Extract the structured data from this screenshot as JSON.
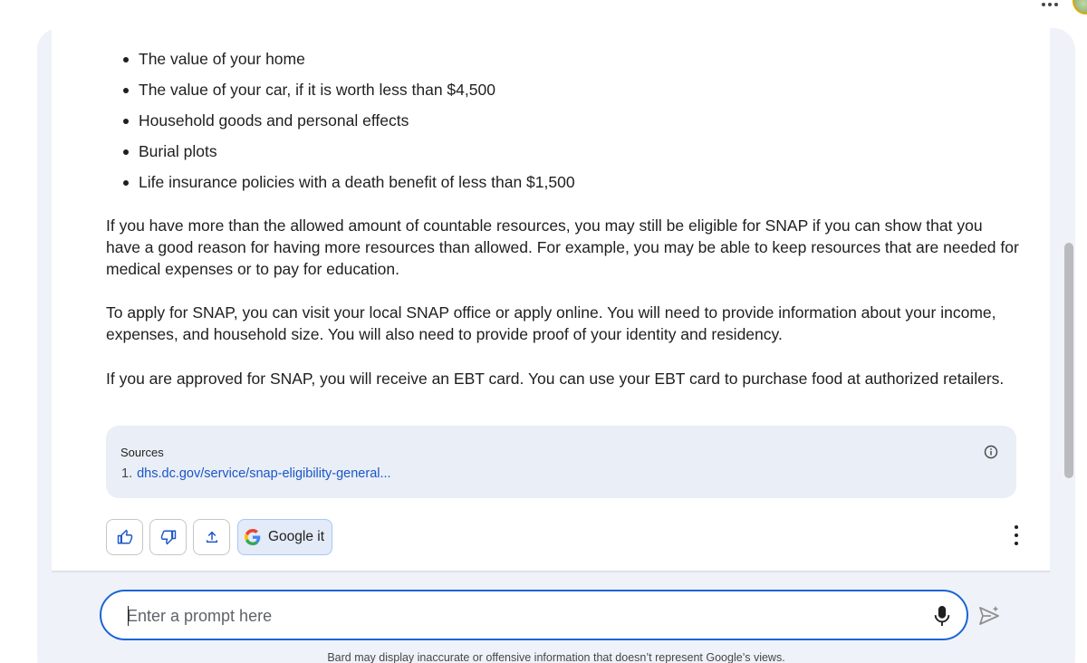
{
  "bullets": [
    "The value of your home",
    "The value of your car, if it is worth less than $4,500",
    "Household goods and personal effects",
    "Burial plots",
    "Life insurance policies with a death benefit of less than $1,500"
  ],
  "paragraphs": [
    "If you have more than the allowed amount of countable resources, you may still be eligible for SNAP if you can show that you have a good reason for having more resources than allowed. For example, you may be able to keep resources that are needed for medical expenses or to pay for education.",
    "To apply for SNAP, you can visit your local SNAP office or apply online. You will need to provide information about your income, expenses, and household size. You will also need to provide proof of your identity and residency.",
    "If you are approved for SNAP, you will receive an EBT card. You can use your EBT card to purchase food at authorized retailers."
  ],
  "sources": {
    "title": "Sources",
    "items": [
      {
        "number": "1.",
        "link": "dhs.dc.gov/service/snap-eligibility-general..."
      }
    ]
  },
  "actions": {
    "google_it_label": "Google it"
  },
  "prompt": {
    "placeholder": "Enter a prompt here",
    "value": ""
  },
  "disclaimer": "Bard may display inaccurate or offensive information that doesn’t represent Google’s views.",
  "icons": {
    "thumbs_up": "thumbs-up-icon",
    "thumbs_down": "thumbs-down-icon",
    "share": "share-icon",
    "google": "google-logo-icon",
    "more": "more-vert-icon",
    "info": "info-icon",
    "mic": "mic-icon",
    "send": "send-icon"
  },
  "colors": {
    "accent": "#1a64d6",
    "link": "#1a56c9",
    "panel": "#f0f2fa",
    "sources_bg": "#eaeef6"
  }
}
